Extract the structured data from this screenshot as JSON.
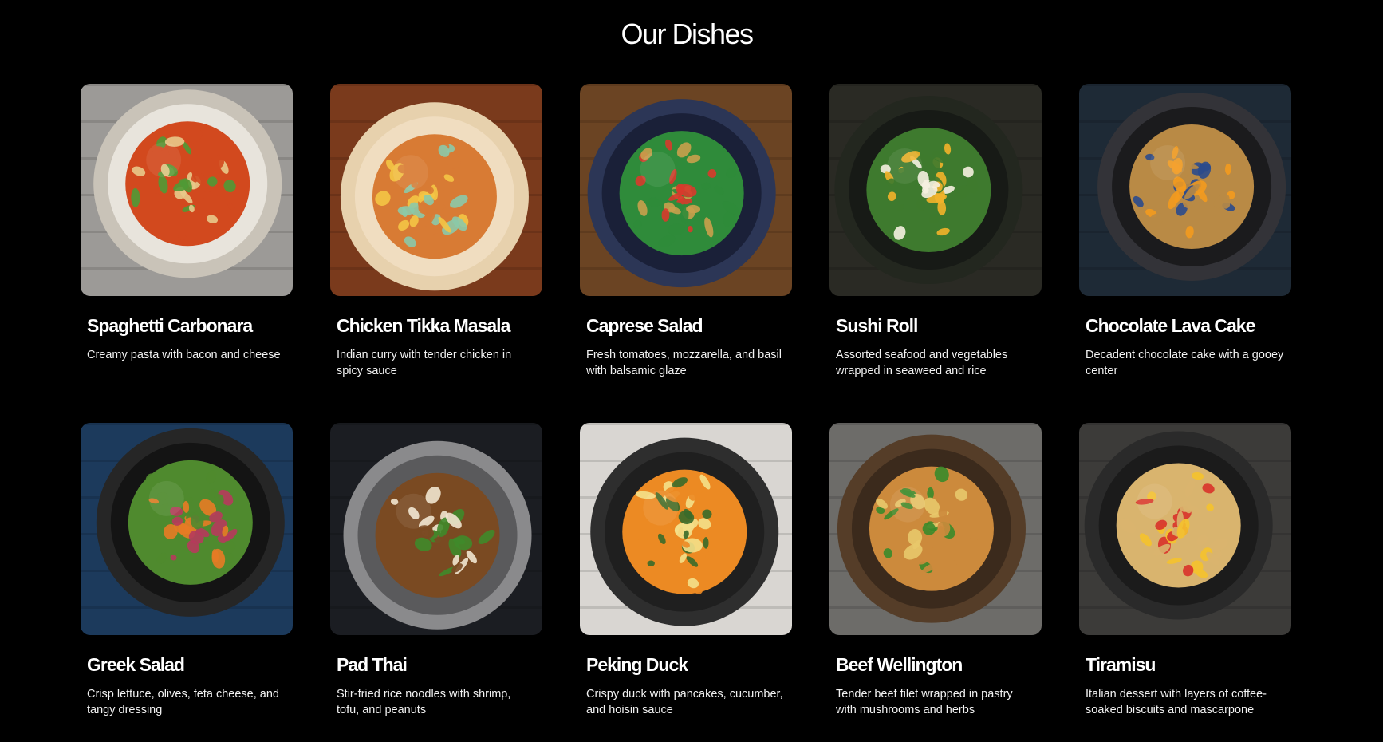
{
  "page": {
    "title": "Our Dishes",
    "background": "#000000"
  },
  "dishes": [
    {
      "name": "Spaghetti Carbonara",
      "description": "Creamy pasta with bacon and cheese",
      "image": "ramen-bowl-bok-choy",
      "colors": {
        "bg": "#9c9a97",
        "plate": "#e8e4dc",
        "rim": "#c9c3b8",
        "food": "#d2491e",
        "accent": "#4f9a35",
        "accent2": "#e8c98a"
      }
    },
    {
      "name": "Chicken Tikka Masala",
      "description": "Indian curry with tender chicken in spicy sauce",
      "image": "ramen-bowl-egg-shrimp-chopsticks",
      "colors": {
        "bg": "#7a3a1c",
        "plate": "#f0ddc0",
        "rim": "#e7d1ad",
        "food": "#d87b34",
        "accent": "#f4c545",
        "accent2": "#8cc9a8"
      }
    },
    {
      "name": "Caprese Salad",
      "description": "Fresh tomatoes, mozzarella, and basil with balsamic glaze",
      "image": "salad-bowl-chickpeas",
      "colors": {
        "bg": "#6b4423",
        "plate": "#1a2038",
        "rim": "#2c3656",
        "food": "#2f8b3a",
        "accent": "#d83a2c",
        "accent2": "#c9a04c"
      }
    },
    {
      "name": "Sushi Roll",
      "description": "Assorted seafood and vegetables wrapped in seaweed and rice",
      "image": "plate-eggs-greens",
      "colors": {
        "bg": "#2a2a24",
        "plate": "#171a16",
        "rim": "#23271f",
        "food": "#3e7a2e",
        "accent": "#f2b32a",
        "accent2": "#f5efe0"
      }
    },
    {
      "name": "Chocolate Lava Cake",
      "description": "Decadent chocolate cake with a gooey center",
      "image": "skillet-pancake-blueberries",
      "colors": {
        "bg": "#1e2a36",
        "plate": "#1b1b1d",
        "rim": "#333338",
        "food": "#b98a45",
        "accent": "#f39a1e",
        "accent2": "#2b4a8c"
      }
    },
    {
      "name": "Greek Salad",
      "description": "Crisp lettuce, olives, feta cheese, and tangy dressing",
      "image": "salad-bowl-onions",
      "colors": {
        "bg": "#1c3a5c",
        "plate": "#141414",
        "rim": "#262626",
        "food": "#4f8a2e",
        "accent": "#e77b25",
        "accent2": "#b63a5c"
      }
    },
    {
      "name": "Pad Thai",
      "description": "Stir-fried rice noodles with shrimp, tofu, and peanuts",
      "image": "pan-meat-naan",
      "colors": {
        "bg": "#1b1d22",
        "plate": "#5a5a5c",
        "rim": "#8a8a8c",
        "food": "#7a4a22",
        "accent": "#f1e6cf",
        "accent2": "#3f8a2a"
      }
    },
    {
      "name": "Peking Duck",
      "description": "Crispy duck with pancakes, cucumber, and hoisin sauce",
      "image": "pan-salmon-curry",
      "colors": {
        "bg": "#d9d6d2",
        "plate": "#1f1f1f",
        "rim": "#2e2e2e",
        "food": "#ec8a23",
        "accent": "#f4e08a",
        "accent2": "#3a6a2a"
      }
    },
    {
      "name": "Beef Wellington",
      "description": "Tender beef filet wrapped in pastry with mushrooms and herbs",
      "image": "coconut-bowl-noodles",
      "colors": {
        "bg": "#6d6c69",
        "plate": "#3b2a1c",
        "rim": "#553d28",
        "food": "#cc8a3c",
        "accent": "#e8c86a",
        "accent2": "#3a8a2a"
      }
    },
    {
      "name": "Tiramisu",
      "description": "Italian dessert with layers of coffee-soaked biscuits and mascarpone",
      "image": "bowl-noodles-egg",
      "colors": {
        "bg": "#3c3b39",
        "plate": "#1b1b1b",
        "rim": "#2a2a2a",
        "food": "#d9b46e",
        "accent": "#f4c22c",
        "accent2": "#d8322a"
      }
    }
  ]
}
